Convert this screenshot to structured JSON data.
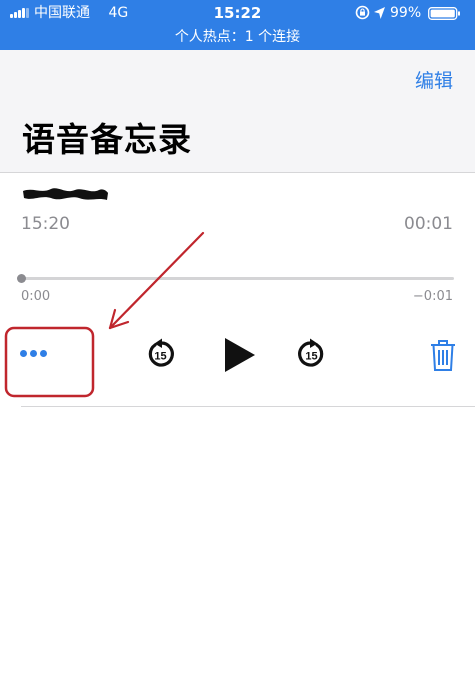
{
  "status_bar": {
    "carrier": "中国联通",
    "network": "4G",
    "time": "15:22",
    "battery_percent": "99%",
    "hotspot_text": "个人热点：1 个连接"
  },
  "header": {
    "edit_label": "编辑",
    "title": "语音备忘录"
  },
  "recording": {
    "time": "15:20",
    "duration": "00:01",
    "progress_fraction": 0,
    "elapsed": "0:00",
    "remaining": "−0:01"
  },
  "controls": {
    "skip_back_label": "15",
    "skip_forward_label": "15"
  },
  "icons": {
    "more": "more-dots-icon",
    "skip_back": "skip-back-15-icon",
    "play": "play-icon",
    "skip_forward": "skip-forward-15-icon",
    "delete": "trash-icon"
  },
  "colors": {
    "accent": "#2f7fe6",
    "annotation": "#c0262d",
    "secondary_text": "#8b8b90"
  }
}
